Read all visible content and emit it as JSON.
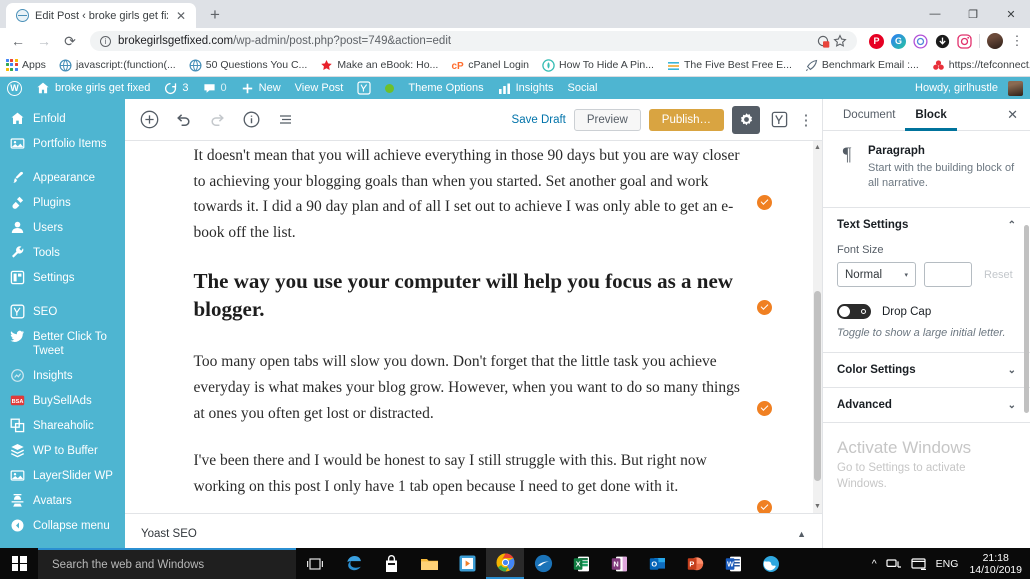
{
  "browser": {
    "tab": {
      "title": "Edit Post ‹ broke girls get fixed —",
      "close_label": "✕",
      "favicon": "globe-icon"
    },
    "newtab_label": "+",
    "window_controls": {
      "minimize": "—",
      "maximize": "❐",
      "close": "✕"
    },
    "nav": {
      "back": "←",
      "forward": "→",
      "reload": "⟳"
    },
    "omnibox": {
      "host": "brokegirlsgetfixed.com",
      "path": "/wp-admin/post.php?post=749&action=edit",
      "info_icon": "info-circle-icon",
      "star_icon": "bookmark-star-icon",
      "shield_icon": "cookie-block-icon"
    },
    "extensions": [
      "pinterest-icon",
      "grammarly-icon",
      "circle-ring-icon",
      "download-arrow-icon",
      "instagram-icon"
    ],
    "profile": "avatar",
    "menu_label": "⋮",
    "bookmarks": [
      {
        "label": "Apps",
        "icon": "apps-grid-icon"
      },
      {
        "label": "javascript:(function(...",
        "icon": "globe-icon"
      },
      {
        "label": "50 Questions You C...",
        "icon": "globe-icon"
      },
      {
        "label": "Make an eBook: Ho...",
        "icon": "star-icon"
      },
      {
        "label": "cPanel Login",
        "icon": "cpanel-icon"
      },
      {
        "label": "How To Hide A Pin...",
        "icon": "teal-circle-icon"
      },
      {
        "label": "The Five Best Free E...",
        "icon": "lines-icon"
      },
      {
        "label": "Benchmark Email :...",
        "icon": "rocket-icon"
      },
      {
        "label": "https://tefconnect.c...",
        "icon": "red-flower-icon"
      }
    ],
    "bookmarks_overflow": "»"
  },
  "wp_adminbar": {
    "logo": "wordpress-icon",
    "site_name": "broke girls get fixed",
    "updates_count": "3",
    "comments_count": "0",
    "new_label": "New",
    "view_post_label": "View Post",
    "yoast_label": "Y",
    "theme_options_label": "Theme Options",
    "insights_label": "Insights",
    "social_label": "Social",
    "howdy": "Howdy, girlhustle"
  },
  "sidebar": {
    "items": [
      {
        "label": "Enfold",
        "icon": "home-icon",
        "gap_after": false
      },
      {
        "label": "Portfolio Items",
        "icon": "portfolio-icon",
        "gap_after": true
      },
      {
        "label": "Appearance",
        "icon": "brush-icon",
        "gap_after": false
      },
      {
        "label": "Plugins",
        "icon": "plug-icon",
        "gap_after": false
      },
      {
        "label": "Users",
        "icon": "users-icon",
        "gap_after": false
      },
      {
        "label": "Tools",
        "icon": "wrench-icon",
        "gap_after": false
      },
      {
        "label": "Settings",
        "icon": "settings-icon",
        "gap_after": true
      },
      {
        "label": "SEO",
        "icon": "yoast-icon",
        "gap_after": false
      },
      {
        "label": "Better Click To Tweet",
        "icon": "twitter-icon",
        "gap_after": false
      },
      {
        "label": "Insights",
        "icon": "insights-icon",
        "gap_after": false
      },
      {
        "label": "BuySellAds",
        "icon": "buysellads-icon",
        "gap_after": false
      },
      {
        "label": "Shareaholic",
        "icon": "shareaholic-icon",
        "gap_after": false
      },
      {
        "label": "WP to Buffer",
        "icon": "layers-icon",
        "gap_after": false
      },
      {
        "label": "LayerSlider WP",
        "icon": "slider-icon",
        "gap_after": false
      },
      {
        "label": "Avatars",
        "icon": "avatar-icon",
        "gap_after": false
      },
      {
        "label": "Collapse menu",
        "icon": "collapse-icon",
        "gap_after": false
      }
    ]
  },
  "editor": {
    "toolbar": {
      "add_block": "＋",
      "undo": "↺",
      "redo": "↻",
      "info": "ⓘ",
      "block_nav": "≡",
      "save_draft": "Save Draft",
      "preview": "Preview",
      "publish": "Publish…",
      "settings_gear": "gear-icon",
      "yoast": "Y",
      "more": "⋮"
    },
    "blocks": [
      {
        "type": "paragraph",
        "text": "It doesn't mean that you will achieve everything in those 90 days but you are way closer to achieving your blogging goals than when you started. Set another goal and work towards it. I did a 90 day plan and of all I set out to achieve I was only able to get an e-book off the list."
      },
      {
        "type": "heading",
        "text": "The way you use your computer will help you focus as a new blogger."
      },
      {
        "type": "paragraph",
        "text": "Too many open tabs will slow you down. Don't forget that the little task you achieve everyday is what makes your blog grow. However, when you want to do so many things at ones you often get lost or distracted."
      },
      {
        "type": "paragraph",
        "text": "I've been there and I would be honest to say I still struggle with this. But right now working on this post I only have 1 tab open because I need to get done with it."
      }
    ],
    "yoast_panel": {
      "label": "Yoast SEO",
      "caret": "▲"
    }
  },
  "settings_panel": {
    "tabs": [
      {
        "label": "Document",
        "active": false
      },
      {
        "label": "Block",
        "active": true
      }
    ],
    "close_label": "✕",
    "block_card": {
      "icon": "¶",
      "title": "Paragraph",
      "description": "Start with the building block of all narrative."
    },
    "text_settings": {
      "title": "Text Settings",
      "chevron": "⌃",
      "font_size_label": "Font Size",
      "font_size_value": "Normal",
      "font_size_custom": "",
      "reset_label": "Reset",
      "drop_cap_label": "Drop Cap",
      "drop_cap_help": "Toggle to show a large initial letter.",
      "drop_cap_on": false
    },
    "color_settings": {
      "title": "Color Settings",
      "chevron": "⌄"
    },
    "advanced": {
      "title": "Advanced",
      "chevron": "⌄"
    },
    "watermark": {
      "title": "Activate Windows",
      "subtitle": "Go to Settings to activate Windows."
    }
  },
  "taskbar": {
    "start": "windows-logo",
    "search_placeholder": "Search the web and Windows",
    "icons": [
      "task-view-icon",
      "edge-icon",
      "store-icon",
      "file-explorer-icon",
      "media-player-icon",
      "chrome-icon",
      "blue-swoosh-icon",
      "excel-icon",
      "onenote-icon",
      "outlook-icon",
      "powerpoint-icon",
      "word-icon",
      "globe-icon"
    ],
    "tray": {
      "chevron": "^",
      "network": "network-icon",
      "action_center": "action-center-icon",
      "language": "ENG"
    },
    "clock": {
      "time": "21:18",
      "date": "14/10/2019"
    }
  },
  "colors": {
    "wp_blue": "#4eb5d1",
    "publish_gold": "#d9a441",
    "link_blue": "#0073aa",
    "grammarly_orange": "#f08022",
    "taskbar_black": "#0a0a0a"
  }
}
